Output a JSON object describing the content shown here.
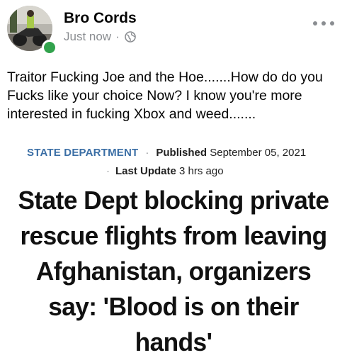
{
  "post": {
    "author": "Bro Cords",
    "time": "Just now",
    "separator": "·",
    "privacy_icon": "globe-icon",
    "more_icon": "more-options-icon",
    "text": "Traitor Fucking Joe and the Hoe.......How do do you Fucks like your choice Now? I know you're more interested in fucking Xbox and weed......."
  },
  "article": {
    "category": "STATE DEPARTMENT",
    "published_label": "Published",
    "published_date": "September 05, 2021",
    "updated_label": "Last Update",
    "updated_value": "3 hrs ago",
    "dot": "·",
    "headline": "State Dept blocking private rescue flights from leaving Afghanistan, organizers say: 'Blood is on their hands'"
  },
  "colors": {
    "online": "#31a24c",
    "category": "#3a6ea5",
    "muted": "#8a8d91"
  }
}
